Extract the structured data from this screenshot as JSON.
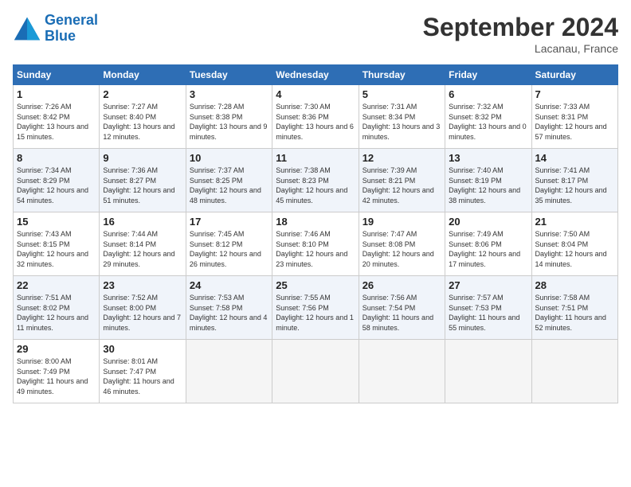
{
  "header": {
    "logo_line1": "General",
    "logo_line2": "Blue",
    "month": "September 2024",
    "location": "Lacanau, France"
  },
  "days_of_week": [
    "Sunday",
    "Monday",
    "Tuesday",
    "Wednesday",
    "Thursday",
    "Friday",
    "Saturday"
  ],
  "weeks": [
    [
      {
        "day": "1",
        "sunrise": "7:26 AM",
        "sunset": "8:42 PM",
        "daylight": "13 hours and 15 minutes."
      },
      {
        "day": "2",
        "sunrise": "7:27 AM",
        "sunset": "8:40 PM",
        "daylight": "13 hours and 12 minutes."
      },
      {
        "day": "3",
        "sunrise": "7:28 AM",
        "sunset": "8:38 PM",
        "daylight": "13 hours and 9 minutes."
      },
      {
        "day": "4",
        "sunrise": "7:30 AM",
        "sunset": "8:36 PM",
        "daylight": "13 hours and 6 minutes."
      },
      {
        "day": "5",
        "sunrise": "7:31 AM",
        "sunset": "8:34 PM",
        "daylight": "13 hours and 3 minutes."
      },
      {
        "day": "6",
        "sunrise": "7:32 AM",
        "sunset": "8:32 PM",
        "daylight": "13 hours and 0 minutes."
      },
      {
        "day": "7",
        "sunrise": "7:33 AM",
        "sunset": "8:31 PM",
        "daylight": "12 hours and 57 minutes."
      }
    ],
    [
      {
        "day": "8",
        "sunrise": "7:34 AM",
        "sunset": "8:29 PM",
        "daylight": "12 hours and 54 minutes."
      },
      {
        "day": "9",
        "sunrise": "7:36 AM",
        "sunset": "8:27 PM",
        "daylight": "12 hours and 51 minutes."
      },
      {
        "day": "10",
        "sunrise": "7:37 AM",
        "sunset": "8:25 PM",
        "daylight": "12 hours and 48 minutes."
      },
      {
        "day": "11",
        "sunrise": "7:38 AM",
        "sunset": "8:23 PM",
        "daylight": "12 hours and 45 minutes."
      },
      {
        "day": "12",
        "sunrise": "7:39 AM",
        "sunset": "8:21 PM",
        "daylight": "12 hours and 42 minutes."
      },
      {
        "day": "13",
        "sunrise": "7:40 AM",
        "sunset": "8:19 PM",
        "daylight": "12 hours and 38 minutes."
      },
      {
        "day": "14",
        "sunrise": "7:41 AM",
        "sunset": "8:17 PM",
        "daylight": "12 hours and 35 minutes."
      }
    ],
    [
      {
        "day": "15",
        "sunrise": "7:43 AM",
        "sunset": "8:15 PM",
        "daylight": "12 hours and 32 minutes."
      },
      {
        "day": "16",
        "sunrise": "7:44 AM",
        "sunset": "8:14 PM",
        "daylight": "12 hours and 29 minutes."
      },
      {
        "day": "17",
        "sunrise": "7:45 AM",
        "sunset": "8:12 PM",
        "daylight": "12 hours and 26 minutes."
      },
      {
        "day": "18",
        "sunrise": "7:46 AM",
        "sunset": "8:10 PM",
        "daylight": "12 hours and 23 minutes."
      },
      {
        "day": "19",
        "sunrise": "7:47 AM",
        "sunset": "8:08 PM",
        "daylight": "12 hours and 20 minutes."
      },
      {
        "day": "20",
        "sunrise": "7:49 AM",
        "sunset": "8:06 PM",
        "daylight": "12 hours and 17 minutes."
      },
      {
        "day": "21",
        "sunrise": "7:50 AM",
        "sunset": "8:04 PM",
        "daylight": "12 hours and 14 minutes."
      }
    ],
    [
      {
        "day": "22",
        "sunrise": "7:51 AM",
        "sunset": "8:02 PM",
        "daylight": "12 hours and 11 minutes."
      },
      {
        "day": "23",
        "sunrise": "7:52 AM",
        "sunset": "8:00 PM",
        "daylight": "12 hours and 7 minutes."
      },
      {
        "day": "24",
        "sunrise": "7:53 AM",
        "sunset": "7:58 PM",
        "daylight": "12 hours and 4 minutes."
      },
      {
        "day": "25",
        "sunrise": "7:55 AM",
        "sunset": "7:56 PM",
        "daylight": "12 hours and 1 minute."
      },
      {
        "day": "26",
        "sunrise": "7:56 AM",
        "sunset": "7:54 PM",
        "daylight": "11 hours and 58 minutes."
      },
      {
        "day": "27",
        "sunrise": "7:57 AM",
        "sunset": "7:53 PM",
        "daylight": "11 hours and 55 minutes."
      },
      {
        "day": "28",
        "sunrise": "7:58 AM",
        "sunset": "7:51 PM",
        "daylight": "11 hours and 52 minutes."
      }
    ],
    [
      {
        "day": "29",
        "sunrise": "8:00 AM",
        "sunset": "7:49 PM",
        "daylight": "11 hours and 49 minutes."
      },
      {
        "day": "30",
        "sunrise": "8:01 AM",
        "sunset": "7:47 PM",
        "daylight": "11 hours and 46 minutes."
      },
      null,
      null,
      null,
      null,
      null
    ]
  ]
}
